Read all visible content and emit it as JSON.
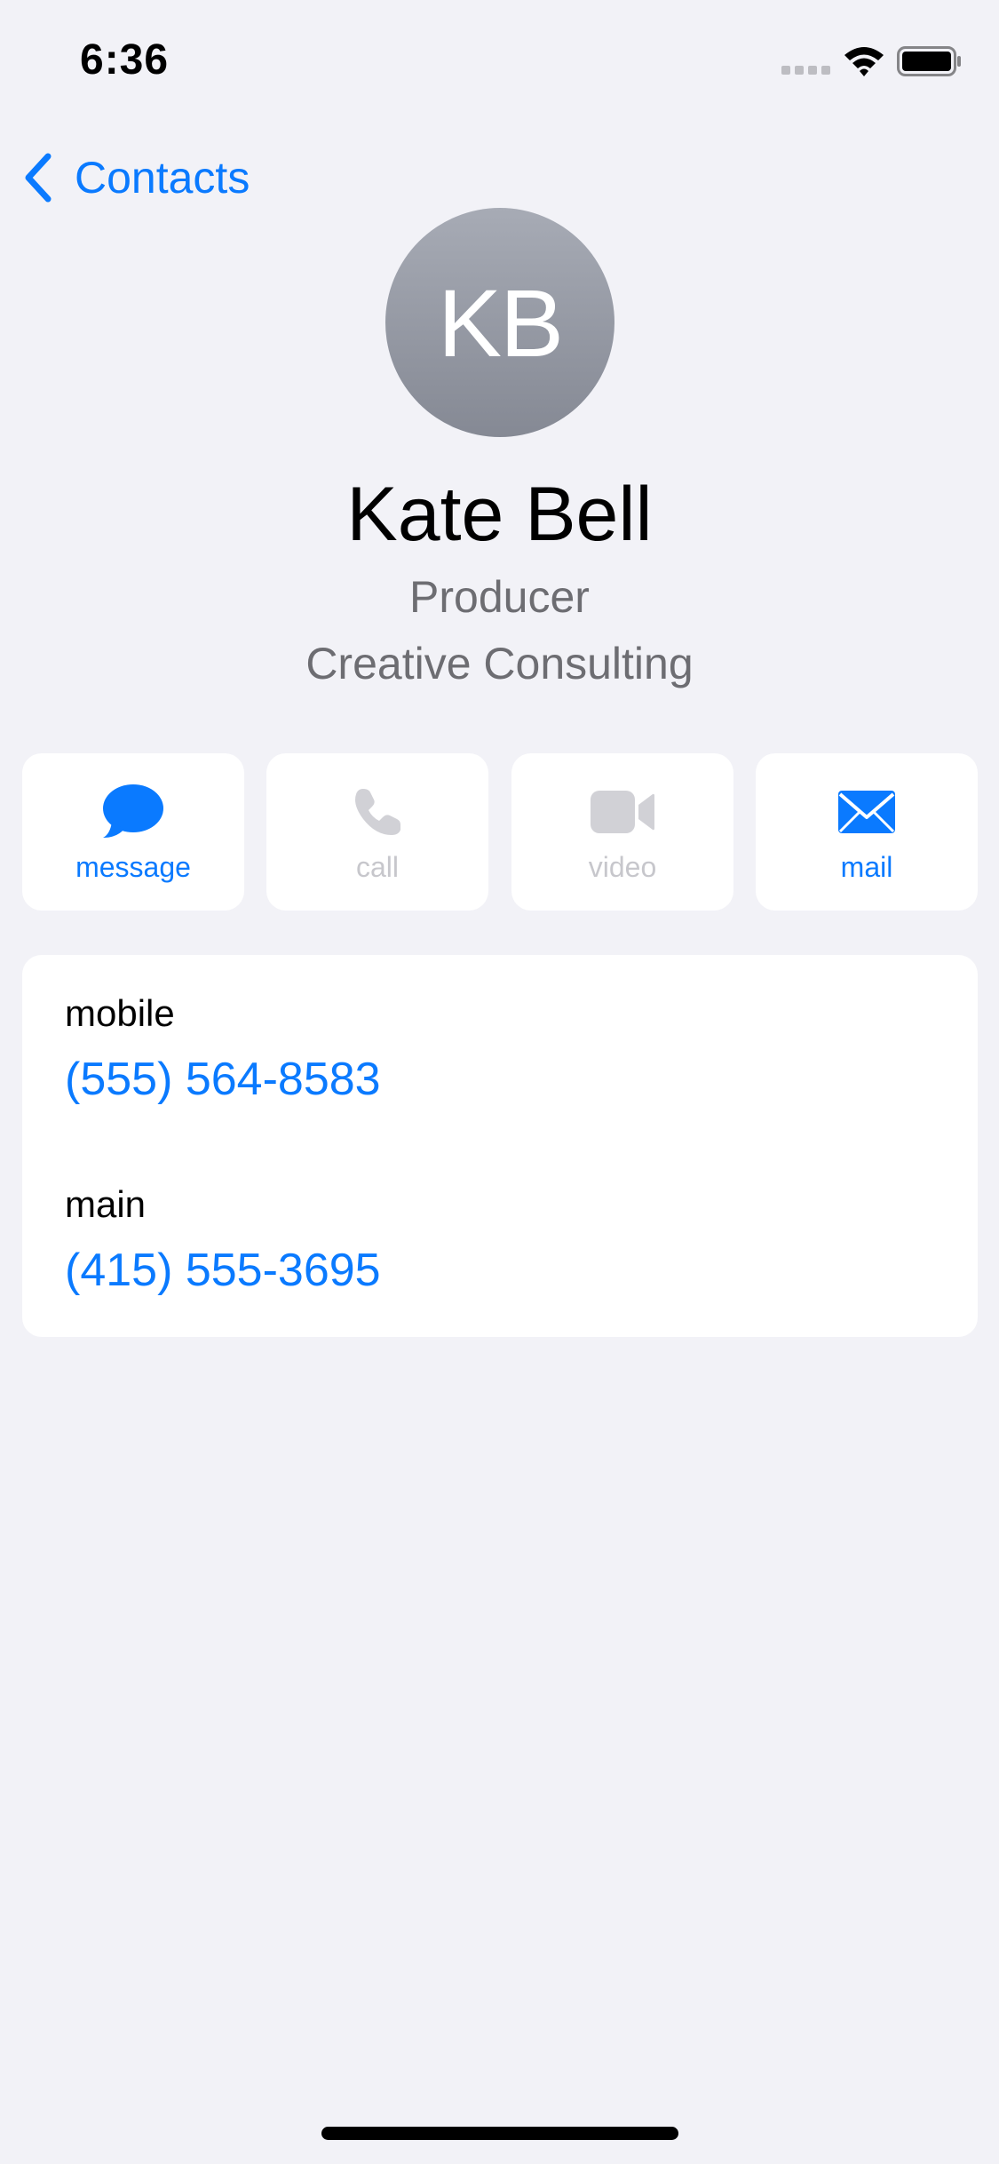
{
  "status_bar": {
    "time": "6:36"
  },
  "nav": {
    "back_label": "Contacts"
  },
  "contact": {
    "initials": "KB",
    "name": "Kate Bell",
    "title": "Producer",
    "company": "Creative Consulting"
  },
  "actions": [
    {
      "label": "message",
      "icon": "message-bubble-icon",
      "enabled": true
    },
    {
      "label": "call",
      "icon": "phone-icon",
      "enabled": false
    },
    {
      "label": "video",
      "icon": "video-camera-icon",
      "enabled": false
    },
    {
      "label": "mail",
      "icon": "envelope-icon",
      "enabled": true
    }
  ],
  "phones": [
    {
      "type": "mobile",
      "number": "(555) 564-8583"
    },
    {
      "type": "main",
      "number": "(415) 555-3695"
    }
  ],
  "colors": {
    "accent": "#0a7aff",
    "disabled": "#c7c7cc",
    "background": "#f2f2f7",
    "secondary_text": "#6d6d72"
  }
}
